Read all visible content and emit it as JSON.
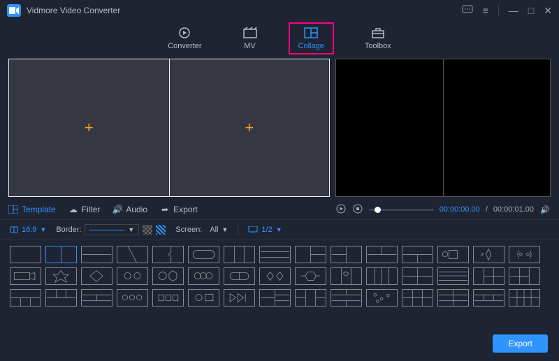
{
  "app_title": "Vidmore Video Converter",
  "nav": {
    "converter": "Converter",
    "mv": "MV",
    "collage": "Collage",
    "toolbox": "Toolbox"
  },
  "subtabs": {
    "template": "Template",
    "filter": "Filter",
    "audio": "Audio",
    "export": "Export"
  },
  "player": {
    "current": "00:00:00.00",
    "duration": "00:00:01.00"
  },
  "options": {
    "aspect": "16:9",
    "border_label": "Border:",
    "screen_label": "Screen:",
    "screen_value": "All",
    "page": "1/2"
  },
  "export_button": "Export"
}
